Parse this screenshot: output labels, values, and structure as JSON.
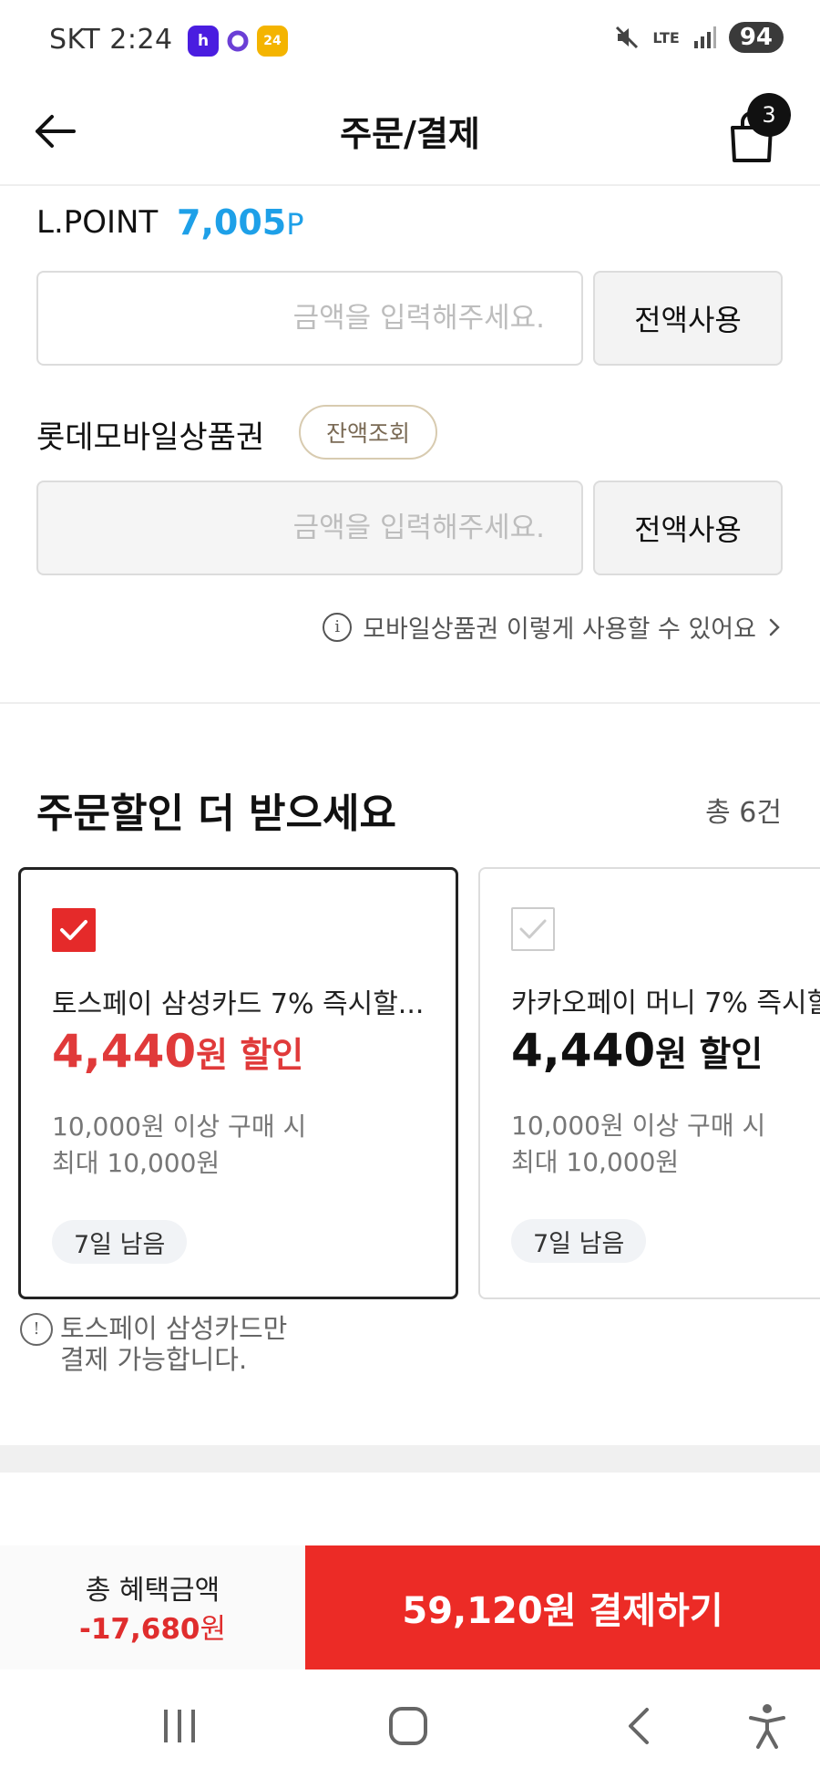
{
  "status_bar": {
    "carrier_time": "SKT 2:24",
    "app_icons": [
      {
        "name": "h-app-icon",
        "text": "h",
        "color": "#4a1de0"
      },
      {
        "name": "circle-app-icon",
        "text": "",
        "color": "#6b3fd6"
      },
      {
        "name": "24-app-icon",
        "text": "24",
        "color": "#f4b400"
      }
    ],
    "network": "LTE",
    "battery": "94"
  },
  "header": {
    "title": "주문/결제",
    "cart_count": "3"
  },
  "lpoint": {
    "label": "L.POINT",
    "value": "7,005",
    "unit": "P",
    "input_placeholder": "금액을 입력해주세요.",
    "full_use_label": "전액사용"
  },
  "gift_card": {
    "label": "롯데모바일상품권",
    "balance_check_label": "잔액조회",
    "input_placeholder": "금액을 입력해주세요.",
    "full_use_label": "전액사용",
    "help_link": "모바일상품권 이렇게 사용할 수 있어요"
  },
  "promotions": {
    "title": "주문할인 더 받으세요",
    "count": "총 6건",
    "cards": [
      {
        "title": "토스페이 삼성카드 7% 즉시할...",
        "amount": "4,440",
        "amount_unit": "원 할인",
        "condition_1": "10,000원 이상 구매 시",
        "condition_2": "최대 10,000원",
        "days_left": "7일 남음",
        "selected": true
      },
      {
        "title": "카카오페이 머니 7% 즉시할",
        "amount": "4,440",
        "amount_unit": "원 할인",
        "condition_1": "10,000원 이상 구매 시",
        "condition_2": "최대 10,000원",
        "days_left": "7일 남음",
        "selected": false
      }
    ],
    "note_line_1": "토스페이 삼성카드만",
    "note_line_2": "결제 가능합니다."
  },
  "bottom_bar": {
    "benefit_label": "총 혜택금액",
    "benefit_value": "-17,680",
    "benefit_unit": "원",
    "pay_label": "59,120원 결제하기"
  },
  "colors": {
    "accent_red": "#ec2b26",
    "point_blue": "#1ea0e8",
    "discount_red": "#e03a3a"
  }
}
